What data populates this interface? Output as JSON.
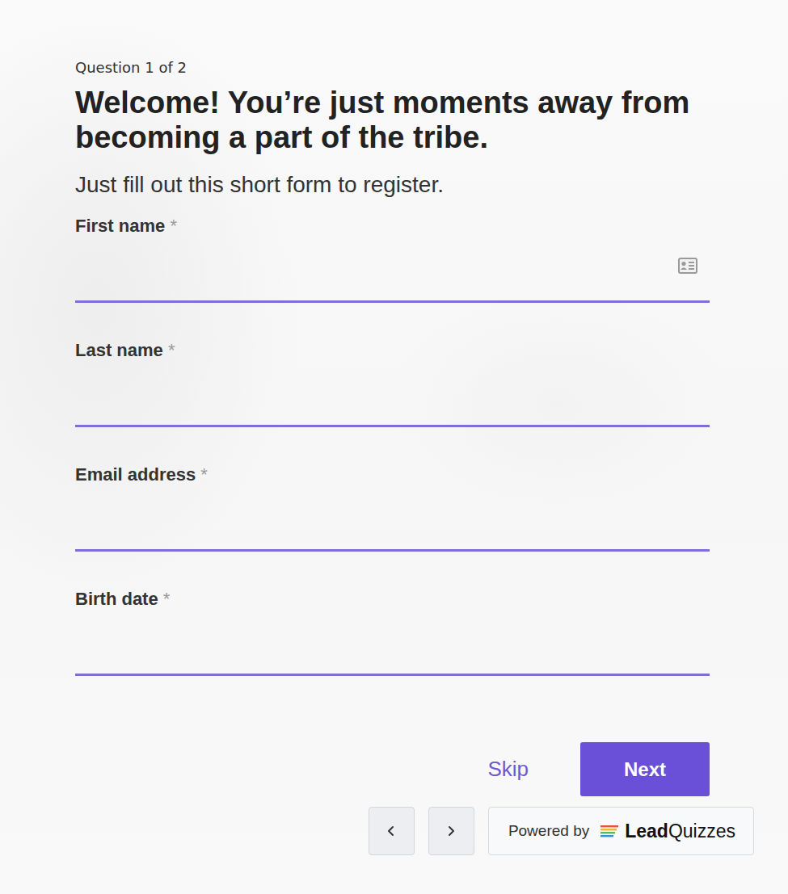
{
  "progress": "Question 1 of 2",
  "title": "Welcome! You’re just moments away from becoming a part of the tribe.",
  "subtitle": "Just fill out this short form to register.",
  "fields": [
    {
      "label": "First name",
      "required_mark": "*",
      "value": "",
      "autofill_icon": true
    },
    {
      "label": "Last name",
      "required_mark": "*",
      "value": "",
      "autofill_icon": false
    },
    {
      "label": "Email address",
      "required_mark": "*",
      "value": "",
      "autofill_icon": false
    },
    {
      "label": "Birth date",
      "required_mark": "*",
      "value": "",
      "autofill_icon": false
    }
  ],
  "actions": {
    "skip": "Skip",
    "next": "Next"
  },
  "footer": {
    "powered_by": "Powered by",
    "brand_bold": "Lead",
    "brand_light": "Quizzes"
  }
}
